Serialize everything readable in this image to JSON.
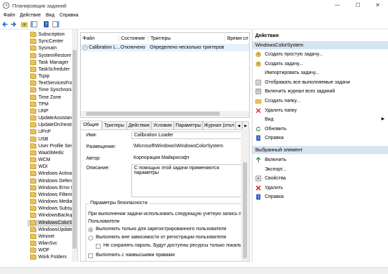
{
  "window": {
    "title": "Планировщик заданий",
    "minimize": "—",
    "maximize": "☐",
    "close": "✕"
  },
  "menu": [
    "Файл",
    "Действие",
    "Вид",
    "Справка"
  ],
  "tree": {
    "items": [
      "Subscription",
      "SyncCenter",
      "Sysmain",
      "SystemRestore",
      "Task Manager",
      "TaskScheduler",
      "Tcpip",
      "TextServicesFramework",
      "Time Synchronization",
      "Time Zone",
      "TPM",
      "UNP",
      "UpdateAssistant",
      "UpdateOrchestrator",
      "UPnP",
      "USB",
      "User Profile Service",
      "WaaSMedic",
      "WCM",
      "WDI",
      "Windows Activation Technologies",
      "Windows Defender",
      "Windows Error Reporting",
      "Windows Filtering Platform",
      "Windows Media Sharing",
      "Windows Subsystem For Linux",
      "WindowsBackup",
      "WindowsColorSystem",
      "WindowsUpdate",
      "Wininet",
      "WlanSvc",
      "WOF",
      "Work Folders"
    ],
    "selected_index": 27
  },
  "tasklist": {
    "columns": [
      "Файл",
      "Состояние",
      "Триггеры",
      "Время сл"
    ],
    "rows": [
      {
        "name": "Calibration L...",
        "status": "Отключено",
        "triggers": "Определено несколько триггеров",
        "next": ""
      }
    ]
  },
  "tabs": [
    "Общие",
    "Триггеры",
    "Действия",
    "Условия",
    "Параметры",
    "Журнал (откл"
  ],
  "general": {
    "name_label": "Имя:",
    "name_value": "Calibration Loader",
    "location_label": "Размещение:",
    "location_value": "\\Microsoft\\Windows\\WindowsColorSystem",
    "author_label": "Автор:",
    "author_value": "Корпорация Майкрософт",
    "description_label": "Описание:",
    "description_value": "С помощью этой задачи применяются параметры",
    "security_group": "Параметры безопасности",
    "security_line": "При выполнении задачи использовать следующую учетную запись по",
    "user": "Пользователи",
    "radio1": "Выполнять только для зарегистрированного пользователя",
    "radio2": "Выполнять вне зависимости от регистрации пользователя",
    "nopass": "Не сохранять пароль. Будут доступны ресурсы только локальн",
    "highest": "Выполнить с наивысшими правами"
  },
  "actions": {
    "header": "Действия",
    "section1": "WindowsColorSystem",
    "items1": [
      {
        "icon": "create-basic-task-icon",
        "label": "Создать простую задачу..."
      },
      {
        "icon": "create-task-icon",
        "label": "Создать задачу..."
      },
      {
        "icon": "",
        "label": "Импортировать задачу..."
      },
      {
        "icon": "running-tasks-icon",
        "label": "Отображать все выполняемые задачи"
      },
      {
        "icon": "history-icon",
        "label": "Включить журнал всех заданий"
      },
      {
        "icon": "new-folder-icon",
        "label": "Создать папку..."
      },
      {
        "icon": "delete-folder-icon",
        "label": "Удалить папку"
      },
      {
        "icon": "",
        "label": "Вид"
      },
      {
        "icon": "refresh-icon",
        "label": "Обновить"
      },
      {
        "icon": "help-icon",
        "label": "Справка"
      }
    ],
    "section2": "Выбранный элемент",
    "items2": [
      {
        "icon": "enable-icon",
        "label": "Включить"
      },
      {
        "icon": "",
        "label": "Экспорт..."
      },
      {
        "icon": "properties-icon",
        "label": "Свойства"
      },
      {
        "icon": "delete-icon",
        "label": "Удалить"
      },
      {
        "icon": "help-icon",
        "label": "Справка"
      }
    ]
  }
}
